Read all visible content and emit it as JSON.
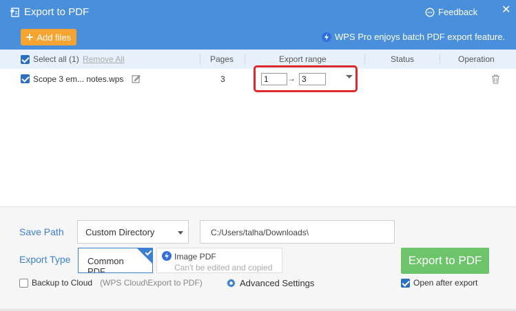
{
  "window": {
    "title": "Export to PDF",
    "feedback_label": "Feedback",
    "close_label": "✕"
  },
  "toolbar": {
    "add_files_label": "Add files",
    "pro_note": "WPS Pro enjoys batch PDF export feature."
  },
  "table": {
    "select_all_label": "Select all (1)",
    "remove_all_label": "Remove All",
    "columns": {
      "pages": "Pages",
      "export_range": "Export range",
      "status": "Status",
      "operation": "Operation"
    },
    "rows": [
      {
        "checked": true,
        "file_name": "Scope 3 em... notes.wps",
        "pages": "3",
        "range_from": "1",
        "range_to": "3",
        "status": ""
      }
    ]
  },
  "settings": {
    "save_path_label": "Save Path",
    "save_path_option": "Custom Directory",
    "save_path_value": "C:/Users/talha/Downloads\\",
    "export_type_label": "Export Type",
    "type_common_label": "Common PDF",
    "type_image_label": "Image PDF",
    "type_image_sub": "Can't be edited and copied",
    "export_button_label": "Export to PDF",
    "backup_label": "Backup to Cloud",
    "backup_hint": "(WPS Cloud\\Export to PDF)",
    "advanced_label": "Advanced Settings",
    "open_after_label": "Open after export",
    "open_after_checked": true,
    "backup_checked": false
  },
  "colors": {
    "title_bar": "#4a8fdb",
    "accent_orange": "#f5a431",
    "export_green": "#6dc46a",
    "highlight_red": "#e0282b",
    "label_blue": "#3c7fce"
  },
  "icons": {
    "title": "export-pdf-icon",
    "feedback": "chat-bubble-icon",
    "pro": "lightning-bolt-icon",
    "edit": "pencil-edit-icon",
    "delete": "trash-icon",
    "advanced": "gear-icon"
  }
}
